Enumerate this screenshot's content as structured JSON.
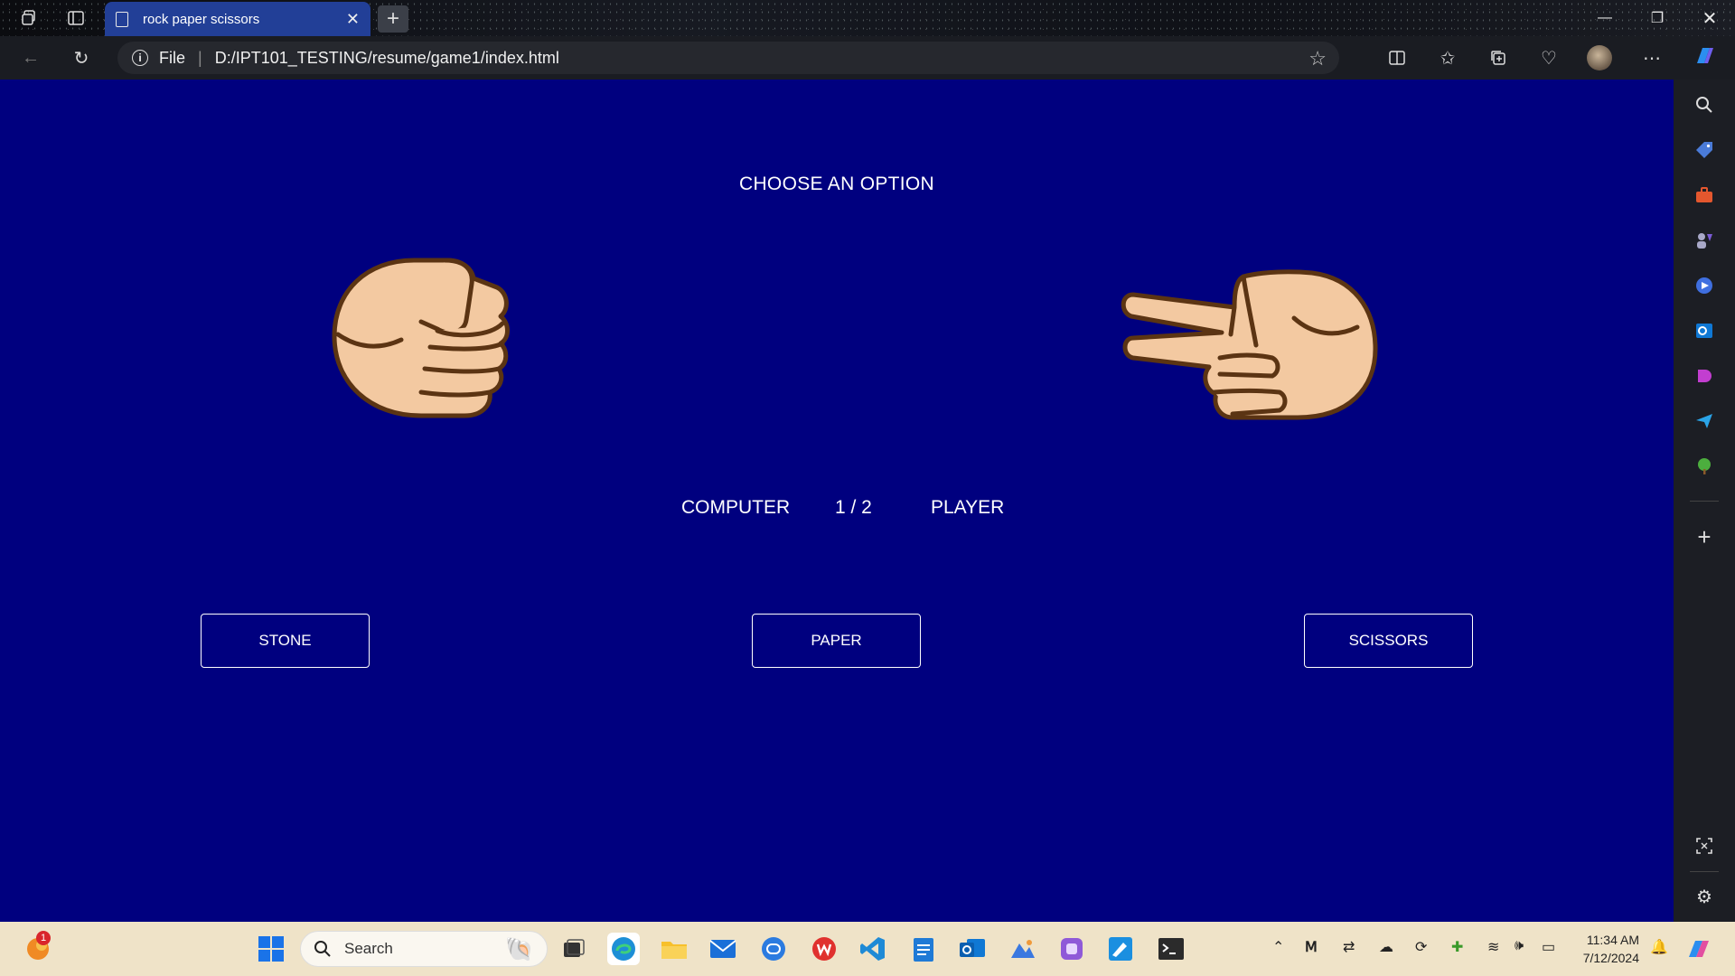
{
  "browser": {
    "tab_title": "rock paper scissors",
    "address_scheme": "File",
    "address_url": "D:/IPT101_TESTING/resume/game1/index.html"
  },
  "game": {
    "heading": "CHOOSE AN OPTION",
    "computer_label": "COMPUTER",
    "score": "1 / 2",
    "player_label": "PLAYER",
    "computer_hand": "rock-hand-icon",
    "player_hand": "scissors-hand-icon",
    "buttons": {
      "stone": "STONE",
      "paper": "PAPER",
      "scissors": "SCISSORS"
    },
    "colors": {
      "background": "#00007f",
      "skin": "#f3c9a1",
      "outline": "#5b3413"
    }
  },
  "taskbar": {
    "search_placeholder": "Search",
    "notification_count": "1",
    "time": "11:34 AM",
    "date": "7/12/2024"
  }
}
